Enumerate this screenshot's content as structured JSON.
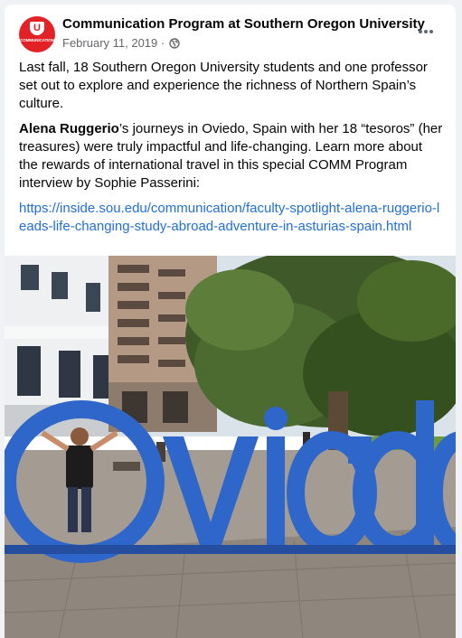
{
  "post": {
    "page_name": "Communication Program at Southern Oregon University",
    "date": "February 11, 2019",
    "separator": " · ",
    "avatar_letter": "U",
    "avatar_text": "COMMUNICATION",
    "paragraph1": "Last fall, 18 Southern Oregon University students and one professor set out to explore and experience the richness of Northern Spain’s culture.",
    "paragraph2_name": "Alena Ruggerio",
    "paragraph2_rest": "’s journeys in Oviedo, Spain with her 18 “tesoros” (her treasures) were truly impactful and life-changing. Learn more about the rewards of international travel in this special COMM Program interview by Sophie Passerini:",
    "link": "https://inside.sou.edu/communication/faculty-spotlight-alena-ruggerio-leads-life-changing-study-abroad-adventure-in-asturias-spain.html"
  },
  "photo": {
    "sign_text": "Oviedo"
  },
  "icons": [
    "globe-icon",
    "more-options-icon"
  ],
  "colors": {
    "brand_red": "#e32227",
    "link_blue": "#216fdb",
    "sign_blue": "#2f66c9",
    "meta_gray": "#65676b"
  }
}
